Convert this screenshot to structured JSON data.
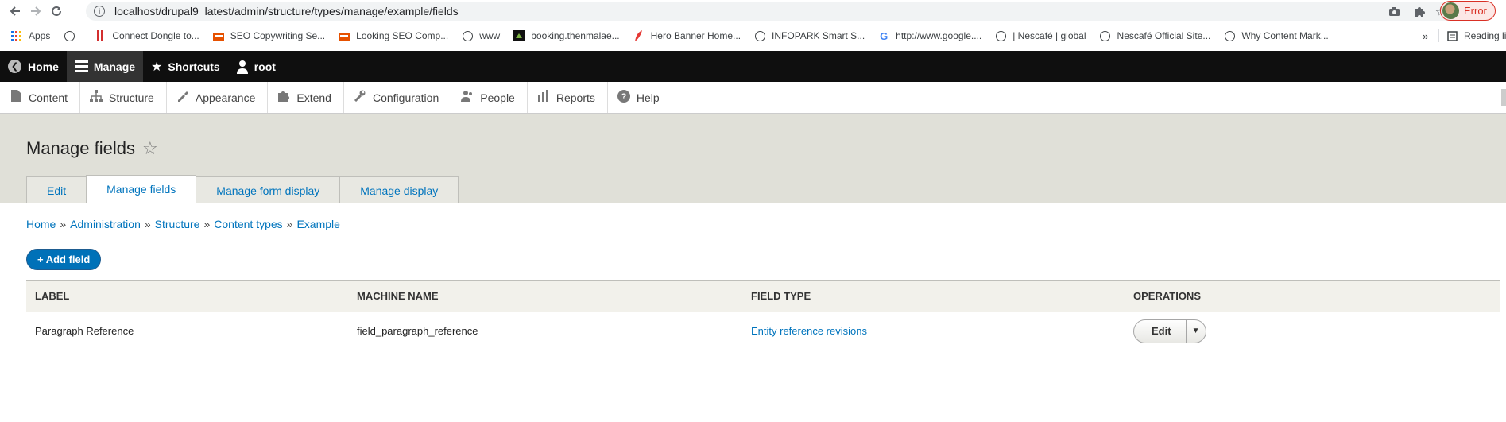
{
  "browser": {
    "url": "localhost/drupal9_latest/admin/structure/types/manage/example/fields",
    "profile_label": "Error",
    "bookmarks": [
      {
        "label": "Apps",
        "icon": "apps-grid-icon"
      },
      {
        "label": "",
        "icon": "globe-icon"
      },
      {
        "label": "Connect Dongle to...",
        "icon": "red-bars-icon"
      },
      {
        "label": "SEO Copywriting Se...",
        "icon": "seo-logo-icon"
      },
      {
        "label": "Looking SEO Comp...",
        "icon": "seo-logo-icon"
      },
      {
        "label": "www",
        "icon": "globe-icon"
      },
      {
        "label": "booking.thenmalae...",
        "icon": "booking-logo-icon"
      },
      {
        "label": "Hero Banner Home...",
        "icon": "red-feather-icon"
      },
      {
        "label": "INFOPARK Smart S...",
        "icon": "globe-icon"
      },
      {
        "label": "http://www.google....",
        "icon": "google-icon"
      },
      {
        "label": "| Nescafé | global",
        "icon": "globe-icon"
      },
      {
        "label": "Nescafé Official Site...",
        "icon": "globe-icon"
      },
      {
        "label": "Why Content Mark...",
        "icon": "globe-icon"
      }
    ],
    "more_label": "»",
    "reading_list_label": "Reading li"
  },
  "toolbar": {
    "home": "Home",
    "manage": "Manage",
    "shortcuts": "Shortcuts",
    "user": "root"
  },
  "tray": {
    "items": [
      {
        "label": "Content",
        "icon": "content-icon"
      },
      {
        "label": "Structure",
        "icon": "structure-icon"
      },
      {
        "label": "Appearance",
        "icon": "appearance-icon"
      },
      {
        "label": "Extend",
        "icon": "extend-icon"
      },
      {
        "label": "Configuration",
        "icon": "configuration-icon"
      },
      {
        "label": "People",
        "icon": "people-icon"
      },
      {
        "label": "Reports",
        "icon": "reports-icon"
      },
      {
        "label": "Help",
        "icon": "help-icon"
      }
    ]
  },
  "page": {
    "title": "Manage fields",
    "tabs": [
      "Edit",
      "Manage fields",
      "Manage form display",
      "Manage display"
    ],
    "active_tab": "Manage fields",
    "breadcrumb": [
      "Home",
      "Administration",
      "Structure",
      "Content types",
      "Example"
    ],
    "breadcrumb_separator": "»",
    "add_field_label": "+ Add field"
  },
  "table": {
    "headers": [
      "Label",
      "Machine name",
      "Field type",
      "Operations"
    ],
    "rows": [
      {
        "label": "Paragraph Reference",
        "machine_name": "field_paragraph_reference",
        "field_type": "Entity reference revisions",
        "operation": "Edit"
      }
    ]
  },
  "colors": {
    "link": "#0074bd",
    "toolbar_bg": "#0f0f0f",
    "header_bg": "#e0e0d8",
    "primary_button": "#0071b8",
    "error_profile": "#d93025"
  }
}
